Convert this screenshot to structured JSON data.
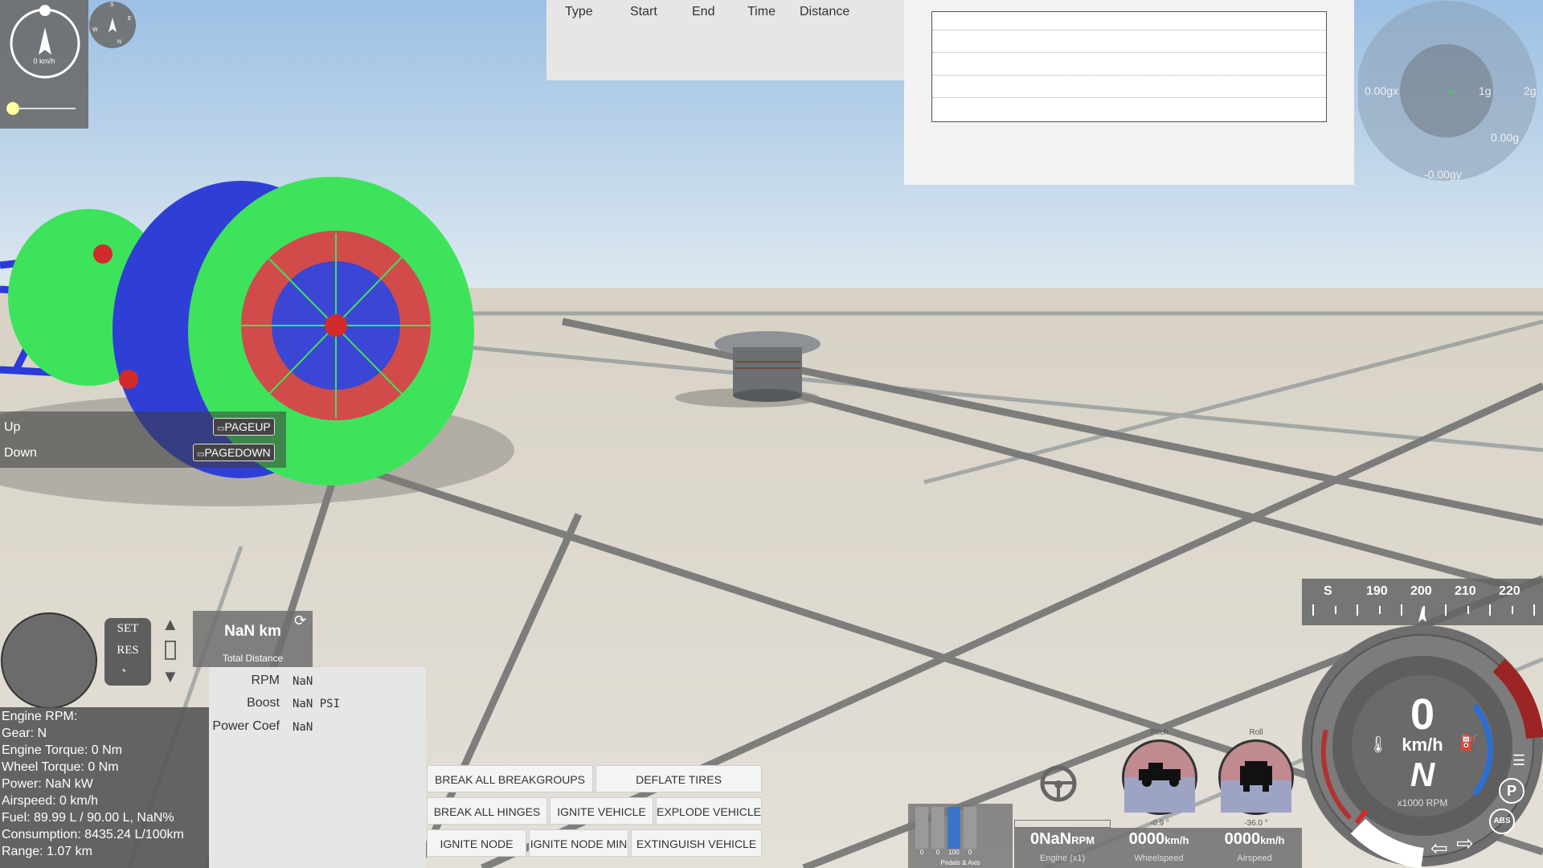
{
  "compass": {
    "speed_text": "0 km/h",
    "n": "N",
    "s": "S",
    "e": "E",
    "w": "W"
  },
  "lap_table": {
    "headers": [
      "Type",
      "Start",
      "End",
      "Time",
      "Distance"
    ]
  },
  "gforce": {
    "gx": "0.00gx",
    "gy": "-0.00gy",
    "g": "0.00g",
    "ring1": "1g",
    "ring2": "2g"
  },
  "camera_keys": [
    {
      "label": "Up",
      "key": "PAGEUP"
    },
    {
      "label": "Down",
      "key": "PAGEDOWN"
    }
  ],
  "cruise": {
    "set": "SET",
    "res": "RES"
  },
  "odometer": {
    "value": "NaN km",
    "label": "Total Distance"
  },
  "engine_readout": [
    {
      "label": "RPM",
      "value": "NaN"
    },
    {
      "label": "Boost",
      "value": "NaN PSI"
    },
    {
      "label": "Power Coef",
      "value": "NaN"
    }
  ],
  "engine_info": [
    "Engine RPM:",
    "Gear: N",
    "Engine Torque: 0 Nm",
    "Wheel Torque: 0 Nm",
    "Power: NaN kW",
    "Airspeed: 0 km/h",
    "Fuel: 89.99 L / 90.00 L, NaN%",
    "Consumption: 8435.24 L/100km",
    "Range: 1.07 km"
  ],
  "actions": {
    "break_all_breakgroups": "BREAK ALL BREAKGROUPS",
    "deflate_tires": "DEFLATE TIRES",
    "break_all_hinges": "BREAK ALL HINGES",
    "ignite_vehicle": "IGNITE VEHICLE",
    "explode_vehicle": "EXPLODE VEHICLE",
    "ignite_node": "IGNITE NODE",
    "ignite_node_min": "IGNITE NODE MIN",
    "extinguish_vehicle": "EXTINGUISH VEHICLE"
  },
  "pedals": {
    "values": [
      "0",
      "0",
      "100",
      "0"
    ],
    "label": "Pedals & Axis",
    "throttle_fraction": 0.0,
    "clutch_fraction": 1.0
  },
  "pitch": {
    "label": "Pitch",
    "value": "-0.9 °"
  },
  "roll": {
    "label": "Roll",
    "value": "-36.0 °"
  },
  "readouts": [
    {
      "value": "0NaN",
      "unit": "RPM",
      "label": "Engine (x1)"
    },
    {
      "value": "0000",
      "unit": "km/h",
      "label": "Wheelspeed"
    },
    {
      "value": "0000",
      "unit": "km/h",
      "label": "Airspeed"
    }
  ],
  "heading": {
    "labels": [
      "S",
      "190",
      "200",
      "210",
      "220"
    ]
  },
  "speedo": {
    "speed": "0",
    "unit": "km/h",
    "gear": "N",
    "rpm_label": "x1000 RPM",
    "abs": "ABS",
    "park": "P"
  },
  "colors": {
    "sky_top": "#a8c7e6",
    "ground": "#d9d3c8",
    "tire_green": "#3ee35c",
    "hub_red": "#d14b4b",
    "blue": "#3040d8",
    "redline": "#9b2424",
    "gauge_blue": "#2a6fd6"
  }
}
